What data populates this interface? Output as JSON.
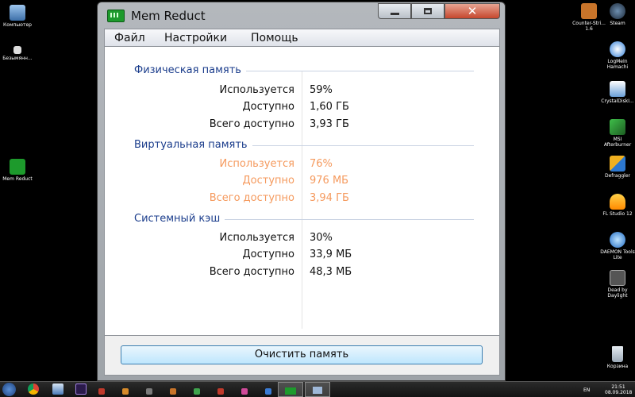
{
  "desktop": {
    "left_icons": [
      {
        "label": "Компьютер"
      },
      {
        "label": "Безымянн..."
      },
      {
        "label": "Mem Reduct"
      }
    ],
    "right_icons": [
      {
        "label": "Counter-Stri... 1.6"
      },
      {
        "label": "Steam"
      },
      {
        "label": "LogMeIn Hamachi"
      },
      {
        "label": "CrystalDiskI..."
      },
      {
        "label": "MSI Afterburner"
      },
      {
        "label": "Defraggler"
      },
      {
        "label": "FL Studio 12"
      },
      {
        "label": "DAEMON Tools Lite"
      },
      {
        "label": "Dead by Daylight"
      },
      {
        "label": "Корзина"
      }
    ]
  },
  "window": {
    "title": "Mem Reduct",
    "close_glyph": "✕"
  },
  "menu": [
    "Файл",
    "Настройки",
    "Помощь"
  ],
  "sections": [
    {
      "title": "Физическая память",
      "warning": false,
      "rows": [
        {
          "label": "Используется",
          "value": "59%"
        },
        {
          "label": "Доступно",
          "value": "1,60 ГБ"
        },
        {
          "label": "Всего доступно",
          "value": "3,93 ГБ"
        }
      ]
    },
    {
      "title": "Виртуальная память",
      "warning": true,
      "rows": [
        {
          "label": "Используется",
          "value": "76%"
        },
        {
          "label": "Доступно",
          "value": "976 МБ"
        },
        {
          "label": "Всего доступно",
          "value": "3,94 ГБ"
        }
      ]
    },
    {
      "title": "Системный кэш",
      "warning": false,
      "rows": [
        {
          "label": "Используется",
          "value": "30%"
        },
        {
          "label": "Доступно",
          "value": "33,9 МБ"
        },
        {
          "label": "Всего доступно",
          "value": "48,3 МБ"
        }
      ]
    }
  ],
  "clean_button": "Очистить память",
  "taskbar": {
    "language": "EN",
    "time": "21:51",
    "date": "08.09.2018"
  },
  "colors": {
    "section_title": "#1b3d8c",
    "warning_text": "#f59a5e",
    "close_button": "#c6472d"
  }
}
